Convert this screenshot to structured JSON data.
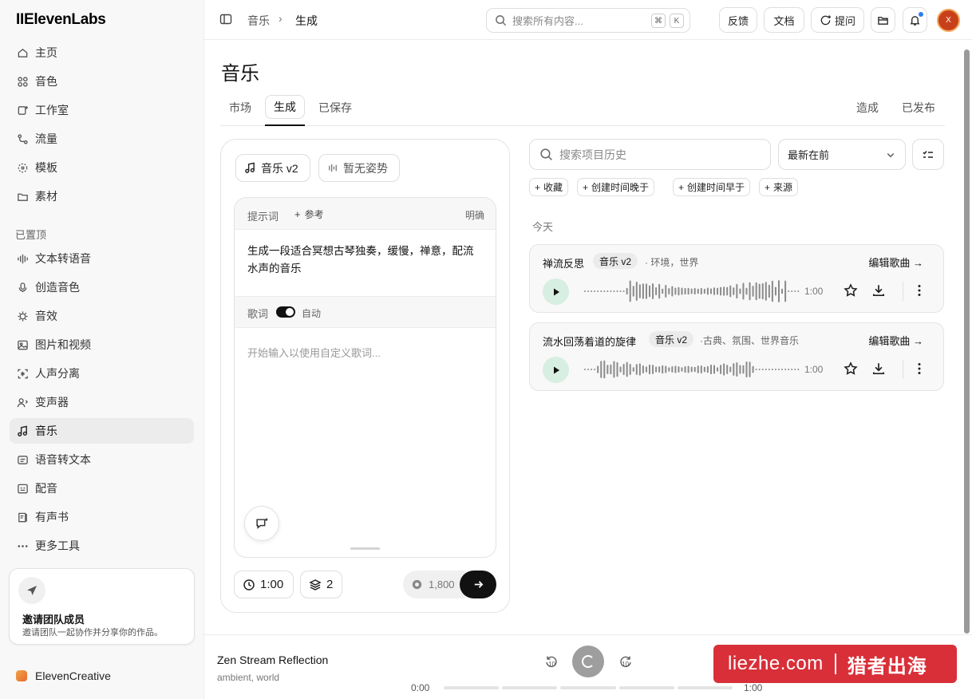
{
  "brand": "IIElevenLabs",
  "nav": {
    "items": [
      {
        "label": "主页",
        "icon": "home-icon"
      },
      {
        "label": "音色",
        "icon": "voices-icon"
      },
      {
        "label": "工作室",
        "icon": "studio-icon"
      },
      {
        "label": "流量",
        "icon": "flows-icon"
      },
      {
        "label": "模板",
        "icon": "templates-icon"
      },
      {
        "label": "素材",
        "icon": "assets-icon"
      }
    ],
    "pinned_label": "已置顶",
    "pinned": [
      {
        "label": "文本转语音",
        "icon": "tts-icon"
      },
      {
        "label": "创造音色",
        "icon": "mic-icon"
      },
      {
        "label": "音效",
        "icon": "sfx-icon"
      },
      {
        "label": "图片和视频",
        "icon": "image-video-icon"
      },
      {
        "label": "人声分离",
        "icon": "isolator-icon"
      },
      {
        "label": "变声器",
        "icon": "changer-icon"
      },
      {
        "label": "音乐",
        "icon": "music-note-icon",
        "active": true
      },
      {
        "label": "语音转文本",
        "icon": "stt-icon"
      },
      {
        "label": "配音",
        "icon": "dubbing-icon"
      },
      {
        "label": "有声书",
        "icon": "audiobook-icon"
      },
      {
        "label": "更多工具",
        "icon": "more-tools-icon"
      }
    ]
  },
  "invite": {
    "title": "邀请团队成员",
    "desc": "邀请团队一起协作并分享你的作品。"
  },
  "workspace": "ElevenCreative",
  "topbar": {
    "breadcrumb": [
      "音乐",
      "生成"
    ],
    "search_placeholder": "搜索所有内容...",
    "kbd": [
      "⌘",
      "K"
    ],
    "feedback": "反馈",
    "docs": "文档",
    "ask": "提问",
    "avatar_initial": "X"
  },
  "page": {
    "title": "音乐",
    "tabs": [
      "市场",
      "生成",
      "已保存"
    ],
    "right_tabs": [
      "造成",
      "已发布"
    ]
  },
  "composer": {
    "model": "音乐 v2",
    "style": "暂无姿势",
    "prompt_label": "提示词",
    "reference": "参考",
    "explicit": "明确",
    "prompt_text": "生成一段适合冥想古琴独奏，缓慢，禅意，配流水声的音乐",
    "lyrics_label": "歌词",
    "lyrics_toggle": "自动",
    "lyrics_placeholder": "开始输入以使用自定义歌词...",
    "duration": "1:00",
    "variants": "2",
    "credits": "1,800"
  },
  "history": {
    "search_placeholder": "搜索项目历史",
    "sort": "最新在前",
    "chips": [
      "收藏",
      "创建时间晚于",
      "创建时间早于",
      "来源"
    ],
    "group": "今天",
    "edit_label": "编辑歌曲",
    "tracks": [
      {
        "name": "禅流反思",
        "badge": "音乐 v2",
        "tags": "· 环境，世界",
        "duration": "1:00"
      },
      {
        "name": "流水回荡着道的旋律",
        "badge": "音乐 v2",
        "tags": "·古典、氛围、世界音乐",
        "duration": "1:00"
      }
    ]
  },
  "player": {
    "title": "Zen Stream Reflection",
    "subtitle": "ambient, world",
    "elapsed": "0:00",
    "total": "1:00",
    "skip_back": "10",
    "skip_fwd": "10",
    "progress": 0
  },
  "watermark": {
    "site": "liezhe.com",
    "name": "猎者出海"
  }
}
